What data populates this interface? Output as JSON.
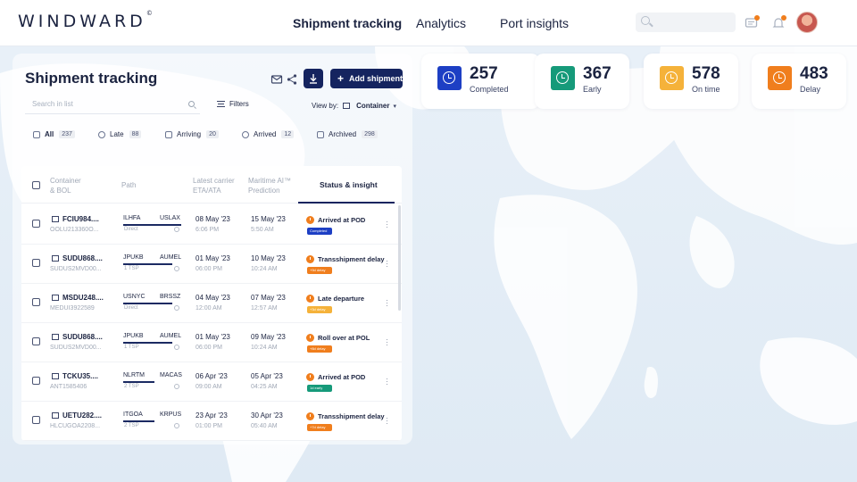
{
  "brand": {
    "logo": "WINDWARD",
    "logo_mark": "©"
  },
  "nav": {
    "links": [
      "Shipment tracking",
      "Analytics",
      "Port insights"
    ],
    "active": 0
  },
  "header": {
    "title": "Shipment tracking",
    "add_button": "Add shipment",
    "search_placeholder": "Search in list",
    "filters_label": "Filters",
    "view_by_label": "View by:",
    "view_by_value": "Container"
  },
  "tabs": [
    {
      "label": "All",
      "count": "237",
      "icon": "list-icon"
    },
    {
      "label": "Late",
      "count": "88",
      "icon": "clock-late-icon"
    },
    {
      "label": "Arriving",
      "count": "20",
      "icon": "ship-icon"
    },
    {
      "label": "Arrived",
      "count": "12",
      "icon": "pin-icon"
    },
    {
      "label": "Archived",
      "count": "298",
      "icon": "archive-icon"
    }
  ],
  "table": {
    "columns": {
      "container": "Container",
      "container2": "& BOL",
      "path": "Path",
      "eta": "Latest carrier",
      "eta2": "ETA/ATA",
      "pred": "Maritime AI™",
      "pred2": "Prediction",
      "status": "Status & insight"
    },
    "rows": [
      {
        "container": "FCIU984....",
        "bol": "OOLU213360O...",
        "from": "ILHFA",
        "to": "USLAX",
        "path_note": "Direct",
        "eta_date": "08 May '23",
        "eta_time": "6:06 PM",
        "pred_date": "15 May '23",
        "pred_time": "5:50 AM",
        "status": "Arrived at POD",
        "badge": "Completed",
        "badge_color": "#1d3fc4"
      },
      {
        "container": "SUDU868....",
        "bol": "SUDUS2MVD00...",
        "from": "JPUKB",
        "to": "AUMEL",
        "path_note": "1 TSP",
        "eta_date": "01 May '23",
        "eta_time": "06:00 PM",
        "pred_date": "10 May '23",
        "pred_time": "10:24 AM",
        "status": "Transshipment delay",
        "badge": "+9d delay",
        "badge_color": "#f07e1d"
      },
      {
        "container": "MSDU248....",
        "bol": "MEDUI3922589",
        "from": "USNYC",
        "to": "BRSSZ",
        "path_note": "Direct",
        "eta_date": "04 May '23",
        "eta_time": "12:00 AM",
        "pred_date": "07 May '23",
        "pred_time": "12:57 AM",
        "status": "Late departure",
        "badge": "+3d delay",
        "badge_color": "#f5b23a"
      },
      {
        "container": "SUDU868....",
        "bol": "SUDUS2MVD00...",
        "from": "JPUKB",
        "to": "AUMEL",
        "path_note": "1 TSP",
        "eta_date": "01 May '23",
        "eta_time": "06:00 PM",
        "pred_date": "09 May '23",
        "pred_time": "10:24 AM",
        "status": "Roll over at POL",
        "badge": "+8d delay",
        "badge_color": "#f07e1d"
      },
      {
        "container": "TCKU35....",
        "bol": "ANT1585406",
        "from": "NLRTM",
        "to": "MACAS",
        "path_note": "2 TSP",
        "eta_date": "06 Apr '23",
        "eta_time": "09:00 AM",
        "pred_date": "05 Apr '23",
        "pred_time": "04:25 AM",
        "status": "Arrived at POD",
        "badge": "1d early",
        "badge_color": "#169a7a"
      },
      {
        "container": "UETU282....",
        "bol": "HLCUGOA2208...",
        "from": "ITGOA",
        "to": "KRPUS",
        "path_note": "2 TSP",
        "eta_date": "23 Apr '23",
        "eta_time": "01:00 PM",
        "pred_date": "30 Apr '23",
        "pred_time": "05:40 AM",
        "status": "Transshipment delay",
        "badge": "+7d delay",
        "badge_color": "#f07e1d"
      }
    ]
  },
  "stats": [
    {
      "value": "257",
      "label": "Completed",
      "color": "#1d3fc4"
    },
    {
      "value": "367",
      "label": "Early",
      "color": "#169a7a"
    },
    {
      "value": "578",
      "label": "On time",
      "color": "#f5b23a"
    },
    {
      "value": "483",
      "label": "Delay",
      "color": "#f07e1d"
    }
  ]
}
